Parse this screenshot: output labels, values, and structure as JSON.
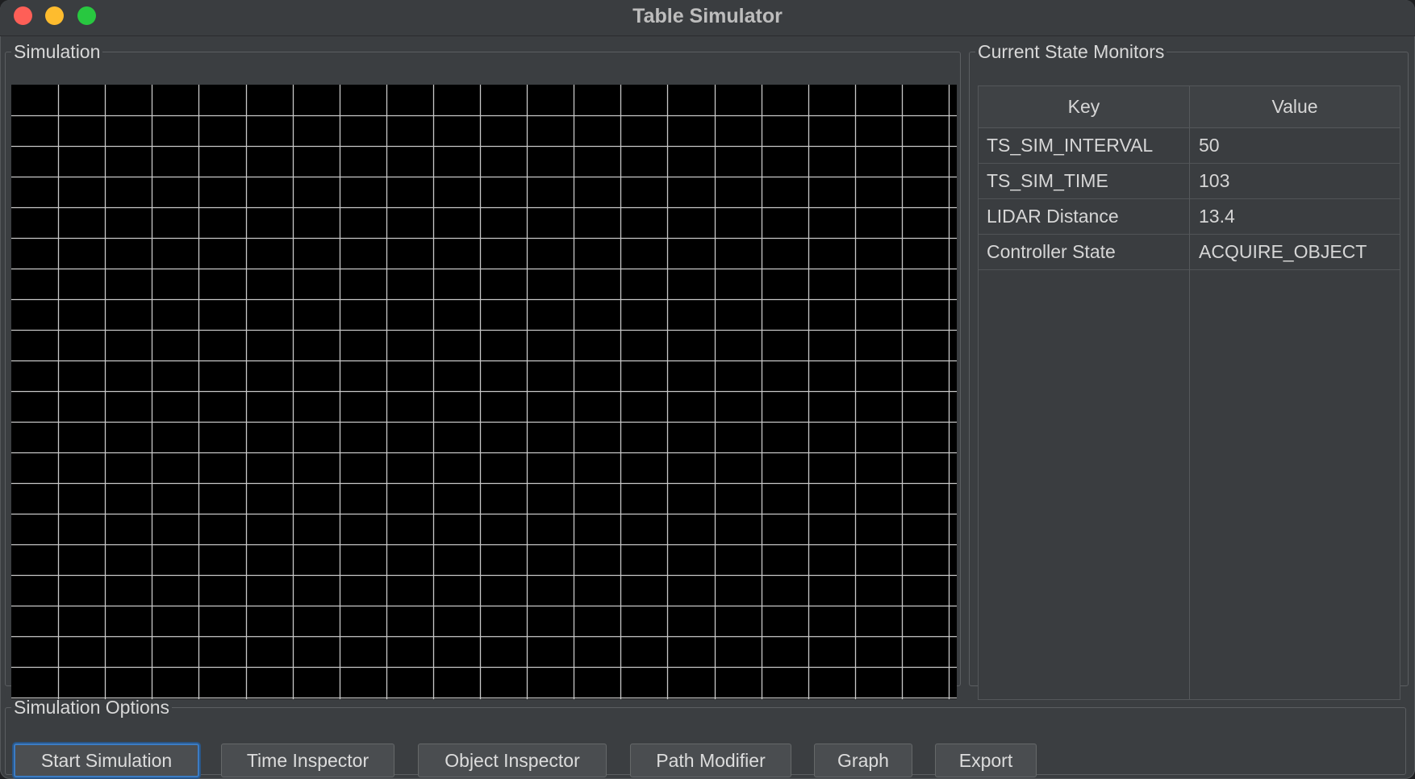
{
  "window": {
    "title": "Table Simulator"
  },
  "simulation": {
    "label": "Simulation",
    "grid_columns": 20,
    "grid_rows": 20,
    "grid_color": "#c8c8c8",
    "background": "#000000"
  },
  "monitors": {
    "label": "Current State Monitors",
    "headers": {
      "key": "Key",
      "value": "Value"
    },
    "rows": [
      {
        "key": "TS_SIM_INTERVAL",
        "value": "50"
      },
      {
        "key": "TS_SIM_TIME",
        "value": "103"
      },
      {
        "key": "LIDAR Distance",
        "value": "13.4"
      },
      {
        "key": "Controller State",
        "value": "ACQUIRE_OBJECT"
      }
    ]
  },
  "options": {
    "label": "Simulation Options",
    "buttons": [
      {
        "label": "Start Simulation",
        "name": "start-simulation-button"
      },
      {
        "label": "Time Inspector",
        "name": "time-inspector-button"
      },
      {
        "label": "Object Inspector",
        "name": "object-inspector-button"
      },
      {
        "label": "Path Modifier",
        "name": "path-modifier-button"
      },
      {
        "label": "Graph",
        "name": "graph-button"
      },
      {
        "label": "Export",
        "name": "export-button"
      }
    ]
  }
}
